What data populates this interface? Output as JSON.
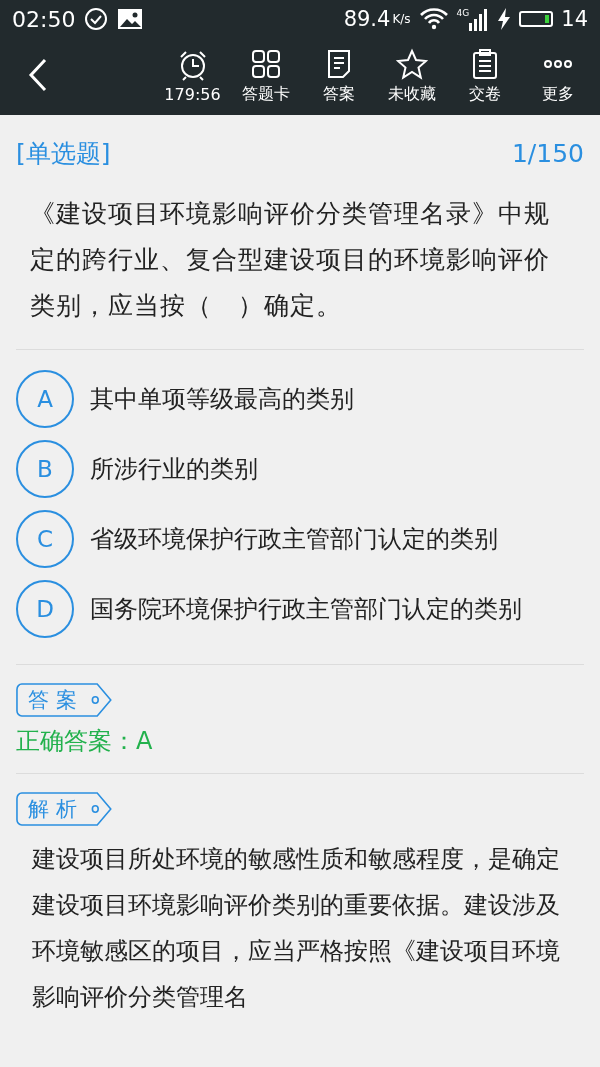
{
  "status_bar": {
    "time": "02:50",
    "speed": "89.4",
    "speed_unit": "K/s",
    "network": "4G",
    "battery": "14"
  },
  "toolbar": {
    "items": [
      {
        "kind": "timer",
        "label": "179:56"
      },
      {
        "kind": "grid",
        "label": "答题卡"
      },
      {
        "kind": "sheet",
        "label": "答案"
      },
      {
        "kind": "star",
        "label": "未收藏"
      },
      {
        "kind": "clipboard",
        "label": "交卷"
      },
      {
        "kind": "more",
        "label": "更多"
      }
    ]
  },
  "question": {
    "type": "[单选题]",
    "progress": "1/150",
    "text": "《建设项目环境影响评价分类管理名录》中规定的跨行业、复合型建设项目的环境影响评价类别，应当按（　）确定。"
  },
  "options": [
    {
      "letter": "A",
      "text": "其中单项等级最高的类别"
    },
    {
      "letter": "B",
      "text": "所涉行业的类别"
    },
    {
      "letter": "C",
      "text": "省级环境保护行政主管部门认定的类别"
    },
    {
      "letter": "D",
      "text": "国务院环境保护行政主管部门认定的类别"
    }
  ],
  "answer": {
    "tag": "答 案",
    "text": "正确答案：A"
  },
  "analysis": {
    "tag": "解 析",
    "text": "建设项目所处环境的敏感性质和敏感程度，是确定建设项目环境影响评价类别的重要依据。建设涉及环境敏感区的项目，应当严格按照《建设项目环境影响评价分类管理名"
  }
}
